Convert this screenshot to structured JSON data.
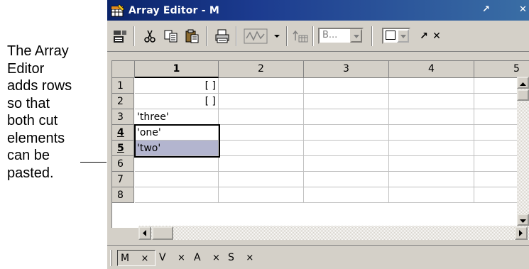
{
  "annotation": {
    "lines": [
      "The Array",
      "Editor",
      "adds rows",
      "so that",
      "both cut",
      "elements",
      "can be",
      "pasted."
    ]
  },
  "window": {
    "title": "Array Editor - M",
    "undock_glyph": "↗",
    "close_glyph": "✕"
  },
  "toolbar": {
    "combo_value": "B...",
    "icons": [
      "import-icon",
      "cut-icon",
      "copy-icon",
      "paste-icon",
      "print-icon",
      "plot-icon",
      "dropdown-arrow-icon",
      "transpose-icon",
      "numeric-format-combo",
      "size-combo",
      "undock-icon",
      "close-icon"
    ]
  },
  "grid": {
    "columns": [
      "1",
      "2",
      "3",
      "4",
      "5"
    ],
    "rows": [
      {
        "label": "1",
        "c1": "[ ]"
      },
      {
        "label": "2",
        "c1": "[ ]"
      },
      {
        "label": "3",
        "c1": "'three'"
      },
      {
        "label": "4",
        "c1": "'one'"
      },
      {
        "label": "5",
        "c1": "'two'"
      },
      {
        "label": "6",
        "c1": ""
      },
      {
        "label": "7",
        "c1": ""
      },
      {
        "label": "8",
        "c1": ""
      }
    ]
  },
  "tabs": [
    {
      "label": "M",
      "close": "×",
      "active": true
    },
    {
      "label": "V",
      "close": "×",
      "active": false
    },
    {
      "label": "A",
      "close": "×",
      "active": false
    },
    {
      "label": "S",
      "close": "×",
      "active": false
    }
  ],
  "colors": {
    "title_start": "#0a246a",
    "title_end": "#3a6ea5",
    "face": "#d4d0c8",
    "selection": "#b3b5cf"
  }
}
